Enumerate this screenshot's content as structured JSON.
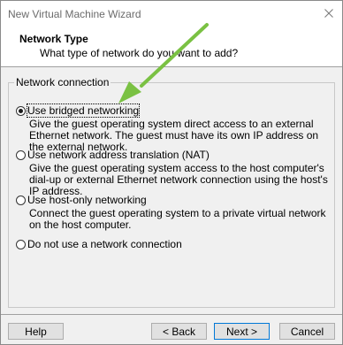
{
  "window": {
    "title": "New Virtual Machine Wizard",
    "close_glyph": "✕"
  },
  "header": {
    "title": "Network Type",
    "subtitle": "What type of network do you want to add?"
  },
  "network_group": {
    "legend": "Network connection",
    "options": [
      {
        "label": "Use bridged networking",
        "description": "Give the guest operating system direct access to an external Ethernet network. The guest must have its own IP address on the external network.",
        "selected": true
      },
      {
        "label": "Use network address translation (NAT)",
        "description": "Give the guest operating system access to the host computer's dial-up or external Ethernet network connection using the host's IP address.",
        "selected": false
      },
      {
        "label": "Use host-only networking",
        "description": "Connect the guest operating system to a private virtual network on the host computer.",
        "selected": false
      },
      {
        "label": "Do not use a network connection",
        "description": "",
        "selected": false
      }
    ]
  },
  "buttons": {
    "help": "Help",
    "back": "< Back",
    "next": "Next >",
    "cancel": "Cancel"
  },
  "colors": {
    "annotation_arrow": "#7ac143",
    "default_button_border": "#0078d7",
    "background": "#f0f0f0"
  },
  "icons": {
    "close": "close-icon",
    "annotation": "arrow-annotation"
  }
}
